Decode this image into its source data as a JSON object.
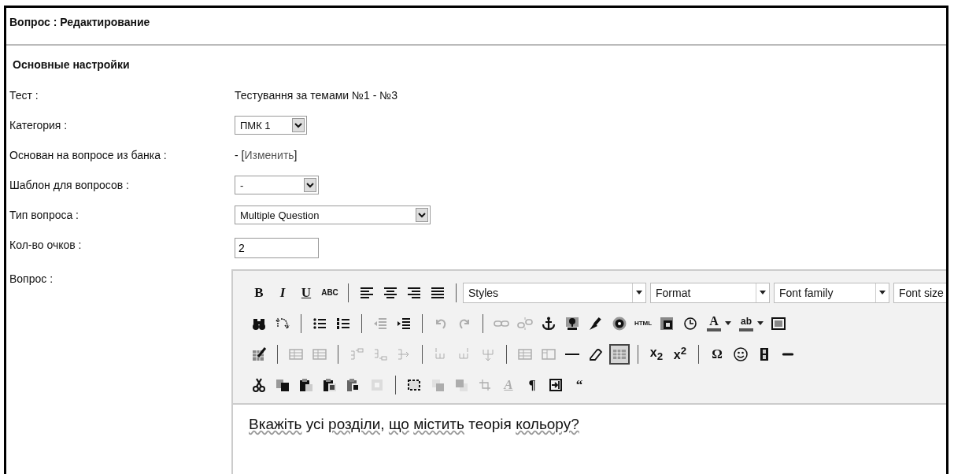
{
  "page_title": "Вопрос : Редактирование",
  "section_title": "Основные настройки",
  "fields": [
    {
      "kind": "text",
      "label": "Тест :",
      "value": "Тестування за темами №1 - №3"
    },
    {
      "kind": "select",
      "label": "Категория :",
      "value": "ПМК 1"
    },
    {
      "kind": "link",
      "label": "Основан на вопросе из банка :",
      "prefix": "- [",
      "link": "Изменить",
      "suffix": "]"
    },
    {
      "kind": "select",
      "label": "Шаблон для вопросов :",
      "value": "-"
    },
    {
      "kind": "select",
      "label": "Тип вопроса :",
      "value": "Multiple Question"
    },
    {
      "kind": "input",
      "label": "Кол-во очков :",
      "value": "2"
    },
    {
      "kind": "editor",
      "label": "Вопрос :"
    }
  ],
  "editor": {
    "toolbar": [
      [
        {
          "kind": "bold",
          "glyph": "B",
          "disabled": false,
          "active": false
        },
        {
          "kind": "italic",
          "glyph": "I",
          "disabled": false,
          "active": false
        },
        {
          "kind": "underline",
          "glyph": "U",
          "disabled": false,
          "active": false
        },
        {
          "kind": "strike",
          "glyph": "ABC",
          "disabled": false,
          "active": false
        },
        {
          "kind": "separator"
        },
        {
          "kind": "align-left",
          "disabled": false,
          "active": false
        },
        {
          "kind": "align-center",
          "disabled": false,
          "active": false
        },
        {
          "kind": "align-right",
          "disabled": false,
          "active": false
        },
        {
          "kind": "justify",
          "disabled": false,
          "active": false
        },
        {
          "kind": "separator"
        },
        {
          "kind": "select",
          "label": "Styles"
        },
        {
          "kind": "select",
          "label": "Format"
        },
        {
          "kind": "select",
          "label": "Font family"
        },
        {
          "kind": "select",
          "label": "Font size"
        }
      ],
      [
        {
          "kind": "find",
          "disabled": false,
          "active": false
        },
        {
          "kind": "replace",
          "disabled": false,
          "active": false
        },
        {
          "kind": "separator"
        },
        {
          "kind": "bullet-list",
          "disabled": false,
          "active": false
        },
        {
          "kind": "numbered-list",
          "disabled": false,
          "active": false
        },
        {
          "kind": "separator"
        },
        {
          "kind": "outdent",
          "disabled": true,
          "active": false
        },
        {
          "kind": "indent",
          "disabled": false,
          "active": false
        },
        {
          "kind": "separator"
        },
        {
          "kind": "undo",
          "disabled": true,
          "active": false
        },
        {
          "kind": "redo",
          "disabled": true,
          "active": false
        },
        {
          "kind": "separator"
        },
        {
          "kind": "link",
          "disabled": true,
          "active": false
        },
        {
          "kind": "unlink",
          "disabled": true,
          "active": false
        },
        {
          "kind": "anchor",
          "disabled": false,
          "active": false
        },
        {
          "kind": "image",
          "disabled": false,
          "active": false
        },
        {
          "kind": "cleanup",
          "disabled": false,
          "active": false
        },
        {
          "kind": "help",
          "disabled": false,
          "active": false
        },
        {
          "kind": "html",
          "glyph": "HTML",
          "disabled": false,
          "active": false
        },
        {
          "kind": "insert-date",
          "disabled": false,
          "active": false
        },
        {
          "kind": "insert-time",
          "disabled": false,
          "active": false
        },
        {
          "kind": "text-color",
          "glyph": "A",
          "disabled": false,
          "active": false
        },
        {
          "kind": "bg-color",
          "glyph": "ab",
          "disabled": false,
          "active": false
        },
        {
          "kind": "window",
          "disabled": false,
          "active": false
        }
      ],
      [
        {
          "kind": "table-props",
          "disabled": false,
          "active": false
        },
        {
          "kind": "separator"
        },
        {
          "kind": "row-props",
          "disabled": true,
          "active": false
        },
        {
          "kind": "cell-props",
          "disabled": true,
          "active": false
        },
        {
          "kind": "separator"
        },
        {
          "kind": "row-before",
          "disabled": true,
          "active": false
        },
        {
          "kind": "row-after",
          "disabled": true,
          "active": false
        },
        {
          "kind": "row-delete",
          "disabled": true,
          "active": false
        },
        {
          "kind": "separator"
        },
        {
          "kind": "col-before",
          "disabled": true,
          "active": false
        },
        {
          "kind": "col-after",
          "disabled": true,
          "active": false
        },
        {
          "kind": "col-delete",
          "disabled": true,
          "active": false
        },
        {
          "kind": "separator"
        },
        {
          "kind": "split-cells",
          "disabled": true,
          "active": false
        },
        {
          "kind": "merge-cells",
          "disabled": true,
          "active": false
        },
        {
          "kind": "hr",
          "disabled": false,
          "active": false
        },
        {
          "kind": "eraser",
          "disabled": false,
          "active": false
        },
        {
          "kind": "table",
          "disabled": false,
          "active": true
        },
        {
          "kind": "separator"
        },
        {
          "kind": "subscript",
          "glyph": "x$_{2}$",
          "disabled": false,
          "active": false
        },
        {
          "kind": "superscript",
          "glyph": "x$^{2}$",
          "disabled": false,
          "active": false
        },
        {
          "kind": "separator"
        },
        {
          "kind": "charmap",
          "glyph": "Ω",
          "disabled": false,
          "active": false
        },
        {
          "kind": "emotions",
          "disabled": false,
          "active": false
        },
        {
          "kind": "media",
          "disabled": false,
          "active": false
        },
        {
          "kind": "advhr",
          "disabled": false,
          "active": false
        }
      ],
      [
        {
          "kind": "cut",
          "disabled": false,
          "active": false
        },
        {
          "kind": "copy",
          "disabled": false,
          "active": false
        },
        {
          "kind": "paste",
          "disabled": false,
          "active": false
        },
        {
          "kind": "paste-text",
          "disabled": false,
          "active": false
        },
        {
          "kind": "paste-word",
          "disabled": false,
          "active": false
        },
        {
          "kind": "select-all",
          "disabled": true,
          "active": false
        },
        {
          "kind": "separator"
        },
        {
          "kind": "layer",
          "disabled": false,
          "active": false
        },
        {
          "kind": "forward",
          "disabled": true,
          "active": false
        },
        {
          "kind": "backward",
          "disabled": true,
          "active": false
        },
        {
          "kind": "absolute",
          "disabled": true,
          "active": false
        },
        {
          "kind": "style",
          "glyph": "A",
          "disabled": true,
          "active": false
        },
        {
          "kind": "pilcrow",
          "glyph": "¶",
          "disabled": false,
          "active": false
        },
        {
          "kind": "visualchars",
          "disabled": false,
          "active": false
        },
        {
          "kind": "quote",
          "glyph": "“",
          "disabled": false,
          "active": false
        }
      ]
    ],
    "content": [
      {
        "word": "Вкажіть",
        "misspelled": true
      },
      {
        "word": "усі",
        "misspelled": false
      },
      {
        "word": "розділи,",
        "misspelled": true
      },
      {
        "word": "що",
        "misspelled": true
      },
      {
        "word": "містить",
        "misspelled": true
      },
      {
        "word": "теорія",
        "misspelled": false
      },
      {
        "word": "кольору?",
        "misspelled": true
      }
    ]
  }
}
